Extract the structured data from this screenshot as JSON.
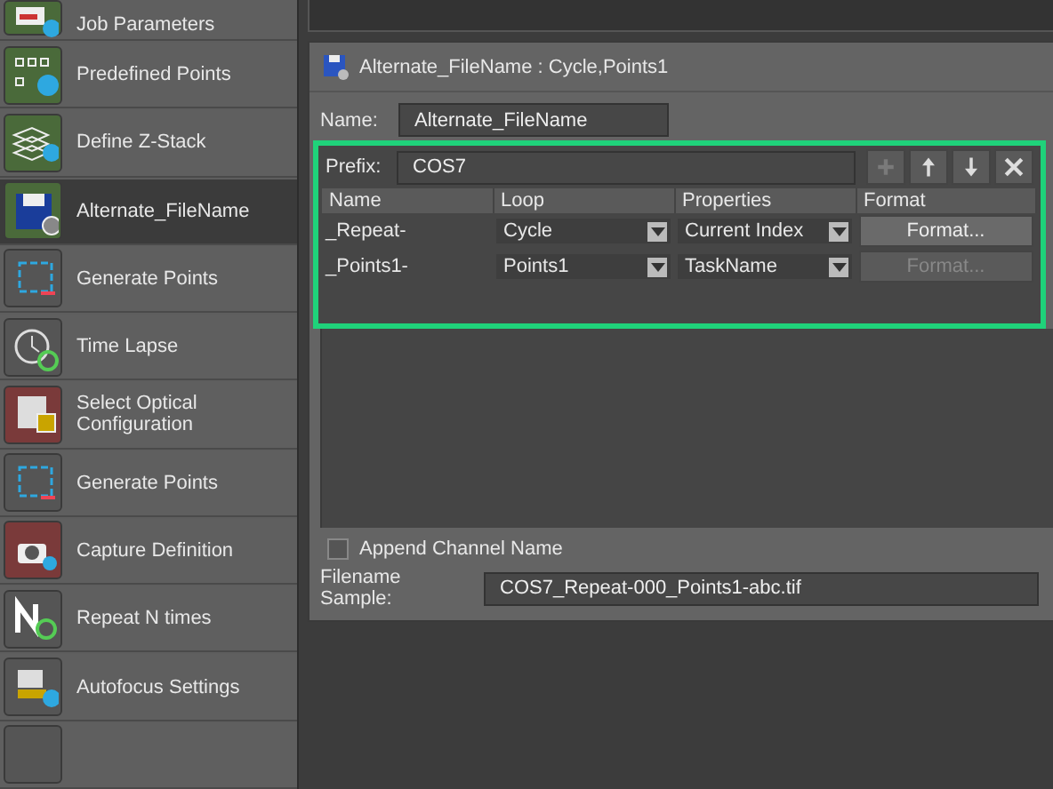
{
  "sidebar": {
    "items": [
      {
        "label": "Job Parameters",
        "kind": "job",
        "color": "#4a6a3a",
        "selected": false
      },
      {
        "label": "Predefined Points",
        "kind": "points",
        "color": "#4a6a3a",
        "selected": false
      },
      {
        "label": "Define Z-Stack",
        "kind": "zstack",
        "color": "#4a6a3a",
        "selected": false
      },
      {
        "label": "Alternate_FileName",
        "kind": "save",
        "color": "#4a6a3a",
        "selected": true
      },
      {
        "label": "Generate Points",
        "kind": "grid",
        "color": "#555555",
        "selected": false
      },
      {
        "label": "Time Lapse",
        "kind": "clock",
        "color": "#555555",
        "selected": false
      },
      {
        "label": "Select Optical Configuration",
        "kind": "optical",
        "color": "#7a3a3a",
        "selected": false
      },
      {
        "label": "Generate Points",
        "kind": "grid",
        "color": "#555555",
        "selected": false
      },
      {
        "label": "Capture Definition",
        "kind": "camera",
        "color": "#7a3a3a",
        "selected": false
      },
      {
        "label": "Repeat N times",
        "kind": "repeat",
        "color": "#555555",
        "selected": false
      },
      {
        "label": "Autofocus Settings",
        "kind": "autofocus",
        "color": "#555555",
        "selected": false
      }
    ]
  },
  "panel": {
    "title": "Alternate_FileName  :  Cycle,Points1",
    "name_label": "Name:",
    "name_value": "Alternate_FileName",
    "prefix_label": "Prefix:",
    "prefix_value": "COS7",
    "toolbar": [
      {
        "kind": "add",
        "disabled": true
      },
      {
        "kind": "up",
        "disabled": false
      },
      {
        "kind": "down",
        "disabled": false
      },
      {
        "kind": "delete",
        "disabled": false
      }
    ],
    "table": {
      "columns": [
        "Name",
        "Loop",
        "Properties",
        "Format"
      ],
      "rows": [
        {
          "name": "_Repeat-",
          "loop": "Cycle",
          "properties": "Current Index",
          "format": "Format...",
          "format_disabled": false
        },
        {
          "name": "_Points1-",
          "loop": "Points1",
          "properties": "TaskName",
          "format": "Format...",
          "format_disabled": true
        }
      ]
    },
    "append_channel": {
      "label": "Append Channel Name",
      "checked": false
    },
    "sample_label": "Filename Sample:",
    "sample_value": "COS7_Repeat-000_Points1-abc.tif"
  }
}
